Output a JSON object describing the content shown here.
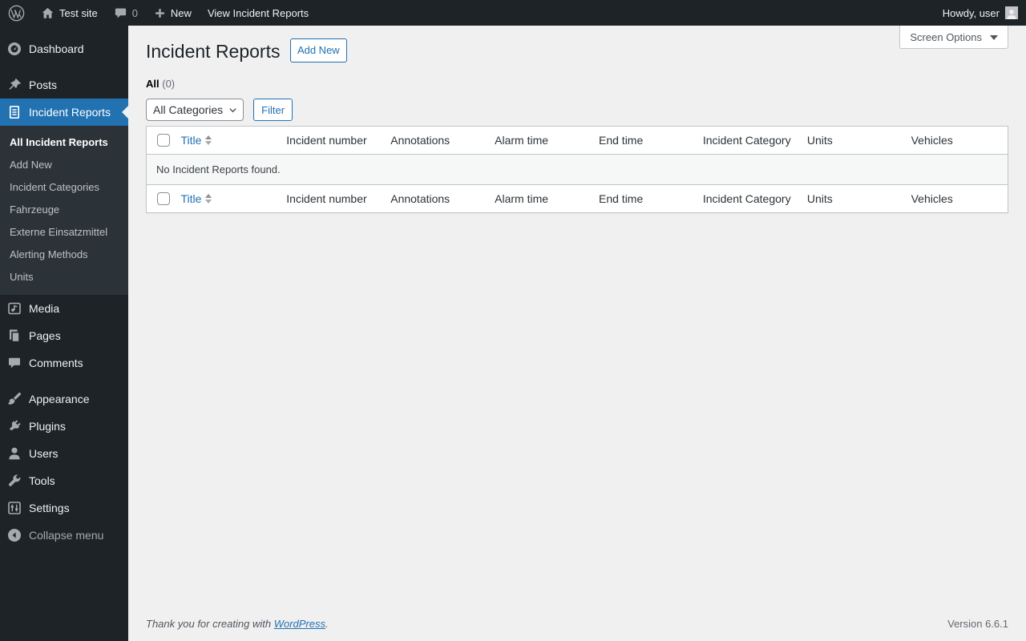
{
  "colors": {
    "accent": "#2271b1",
    "menu_bg": "#1d2327",
    "submenu_bg": "#2c3338",
    "content_bg": "#f0f0f1"
  },
  "admin_bar": {
    "site_name": "Test site",
    "comments_count": "0",
    "new_label": "New",
    "view_label": "View Incident Reports",
    "howdy": "Howdy, user"
  },
  "sidebar": {
    "items": [
      {
        "label": "Dashboard"
      },
      {
        "label": "Posts"
      },
      {
        "label": "Incident Reports"
      },
      {
        "label": "Media"
      },
      {
        "label": "Pages"
      },
      {
        "label": "Comments"
      },
      {
        "label": "Appearance"
      },
      {
        "label": "Plugins"
      },
      {
        "label": "Users"
      },
      {
        "label": "Tools"
      },
      {
        "label": "Settings"
      }
    ],
    "submenu": [
      {
        "label": "All Incident Reports"
      },
      {
        "label": "Add New"
      },
      {
        "label": "Incident Categories"
      },
      {
        "label": "Fahrzeuge"
      },
      {
        "label": "Externe Einsatzmittel"
      },
      {
        "label": "Alerting Methods"
      },
      {
        "label": "Units"
      }
    ],
    "collapse_label": "Collapse menu"
  },
  "main": {
    "page_title": "Incident Reports",
    "add_new_label": "Add New",
    "screen_options_label": "Screen Options",
    "views_all": {
      "label": "All",
      "count": "(0)"
    },
    "category_filter_value": "All Categories",
    "filter_button_label": "Filter",
    "table": {
      "columns": [
        "Title",
        "Incident number",
        "Annotations",
        "Alarm time",
        "End time",
        "Incident Category",
        "Units",
        "Vehicles"
      ],
      "empty_message": "No Incident Reports found."
    }
  },
  "footer": {
    "thanks_prefix": "Thank you for creating with",
    "wordpress_link": "WordPress",
    "thanks_suffix": ".",
    "version": "Version 6.6.1"
  }
}
